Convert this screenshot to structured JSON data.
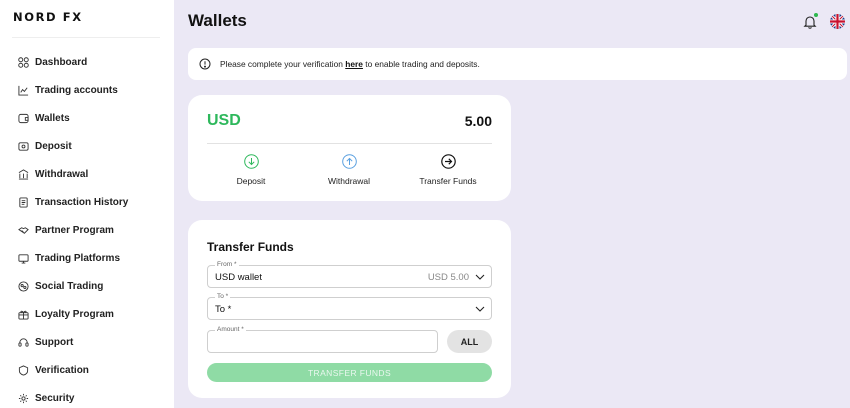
{
  "brand": {
    "logo": "NORD FX"
  },
  "sidebar": {
    "items": [
      {
        "label": "Dashboard",
        "icon": "dashboard-icon"
      },
      {
        "label": "Trading accounts",
        "icon": "chart-icon"
      },
      {
        "label": "Wallets",
        "icon": "wallet-icon"
      },
      {
        "label": "Deposit",
        "icon": "deposit-icon"
      },
      {
        "label": "Withdrawal",
        "icon": "withdrawal-icon"
      },
      {
        "label": "Transaction History",
        "icon": "history-icon"
      },
      {
        "label": "Partner Program",
        "icon": "handshake-icon"
      },
      {
        "label": "Trading Platforms",
        "icon": "platforms-icon"
      },
      {
        "label": "Social Trading",
        "icon": "social-icon"
      },
      {
        "label": "Loyalty Program",
        "icon": "gift-icon"
      },
      {
        "label": "Support",
        "icon": "support-icon"
      },
      {
        "label": "Verification",
        "icon": "shield-icon"
      },
      {
        "label": "Security",
        "icon": "gear-icon"
      }
    ]
  },
  "header": {
    "title": "Wallets",
    "notification_icon": "bell-icon",
    "language_icon": "uk-flag-icon"
  },
  "notice": {
    "prefix": "Please complete your verification ",
    "link": "here",
    "suffix": " to enable trading and deposits."
  },
  "wallet": {
    "currency": "USD",
    "amount": "5.00",
    "actions": [
      {
        "label": "Deposit",
        "icon": "arrow-down-circle-icon"
      },
      {
        "label": "Withdrawal",
        "icon": "arrow-up-circle-icon"
      },
      {
        "label": "Transfer Funds",
        "icon": "arrow-right-circle-icon"
      }
    ]
  },
  "transfer": {
    "title": "Transfer Funds",
    "from_label": "From *",
    "from_value": "USD wallet",
    "from_balance": "USD 5.00",
    "to_label": "To *",
    "to_value": "To *",
    "amount_label": "Amount *",
    "amount_value": "",
    "all_label": "ALL",
    "submit_label": "TRANSFER FUNDS"
  },
  "colors": {
    "background": "#ebe8f5",
    "accent_green": "#2eb85c",
    "disabled_button": "#8fdba5",
    "withdraw_blue": "#5aa0e0"
  }
}
